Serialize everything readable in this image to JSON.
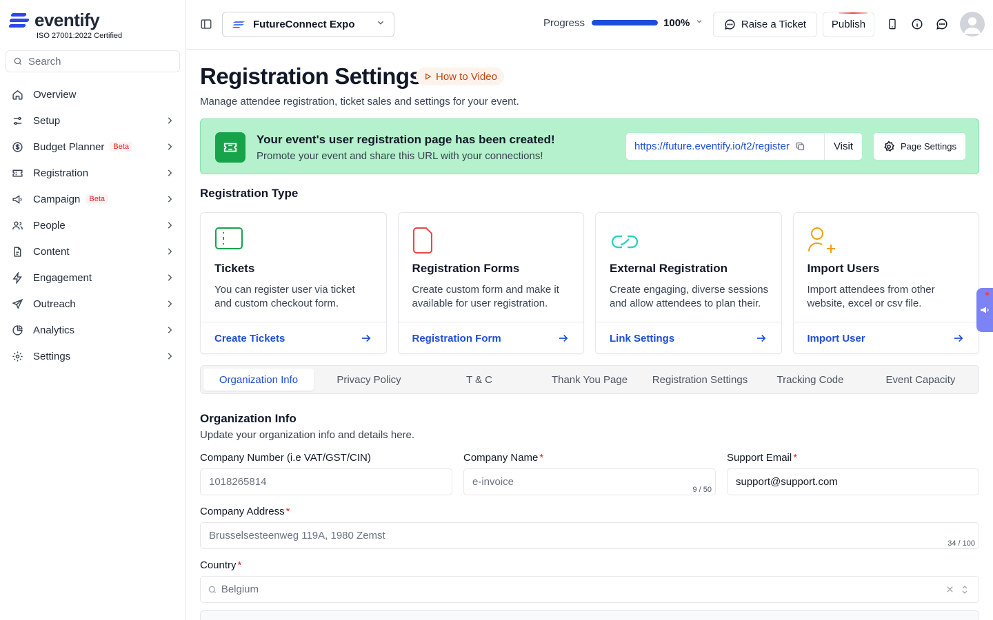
{
  "brand": {
    "name": "eventify",
    "certification": "ISO 27001:2022 Certified"
  },
  "sidebar": {
    "search_placeholder": "Search",
    "items": [
      {
        "label": "Overview",
        "icon": "home-icon",
        "has_chevron": false
      },
      {
        "label": "Setup",
        "icon": "sliders-icon",
        "has_chevron": true
      },
      {
        "label": "Budget Planner",
        "icon": "dollar-icon",
        "badge": "Beta",
        "has_chevron": true
      },
      {
        "label": "Registration",
        "icon": "ticket-icon",
        "has_chevron": true
      },
      {
        "label": "Campaign",
        "icon": "megaphone-icon",
        "badge": "Beta",
        "has_chevron": true
      },
      {
        "label": "People",
        "icon": "users-icon",
        "has_chevron": true
      },
      {
        "label": "Content",
        "icon": "document-icon",
        "has_chevron": true
      },
      {
        "label": "Engagement",
        "icon": "bolt-icon",
        "has_chevron": true
      },
      {
        "label": "Outreach",
        "icon": "send-icon",
        "has_chevron": true
      },
      {
        "label": "Analytics",
        "icon": "pie-chart-icon",
        "has_chevron": true
      },
      {
        "label": "Settings",
        "icon": "gear-icon",
        "has_chevron": true
      }
    ]
  },
  "topbar": {
    "event_name": "FutureConnect Expo",
    "progress_label": "Progress",
    "progress_value": 100,
    "progress_text": "100%",
    "raise_ticket": "Raise a Ticket",
    "publish": "Publish"
  },
  "page": {
    "title": "Registration Settings",
    "how_to": "How to Video",
    "subtitle": "Manage attendee registration, ticket sales and settings for your event."
  },
  "banner": {
    "title": "Your event's user registration page has been created!",
    "subtitle": "Promote your event and share this URL with your connections!",
    "url": "https://future.eventify.io/t2/register",
    "visit": "Visit",
    "page_settings": "Page Settings"
  },
  "registration_type": {
    "title": "Registration Type",
    "cards": [
      {
        "title": "Tickets",
        "desc": "You can register user via ticket and custom checkout form.",
        "link": "Create Tickets",
        "icon": "ticket-outline-icon",
        "color": "#16a34a"
      },
      {
        "title": "Registration Forms",
        "desc": "Create custom form and make it available for user registration.",
        "link": "Registration Form",
        "icon": "file-icon",
        "color": "#ef4444"
      },
      {
        "title": "External Registration",
        "desc": "Create engaging, diverse sessions and allow attendees to plan their.",
        "link": "Link Settings",
        "icon": "link-icon",
        "color": "#2dd4bf"
      },
      {
        "title": "Import Users",
        "desc": "Import attendees from other website, excel or csv file.",
        "link": "Import User",
        "icon": "user-plus-icon",
        "color": "#f59e0b"
      }
    ]
  },
  "tabs": [
    "Organization Info",
    "Privacy Policy",
    "T & C",
    "Thank You Page",
    "Registration Settings",
    "Tracking Code",
    "Event Capacity"
  ],
  "active_tab": 0,
  "org": {
    "title": "Organization Info",
    "subtitle": "Update your organization info and details here.",
    "company_number_label": "Company Number (i.e VAT/GST/CIN)",
    "company_number_placeholder": "1018265814",
    "company_name_label": "Company Name",
    "company_name_placeholder": "e-invoice",
    "company_name_counter": "9 / 50",
    "support_email_label": "Support Email",
    "support_email_value": "support@support.com",
    "address_label": "Company Address",
    "address_placeholder": "Brusselsesteenweg 119A, 1980 Zemst",
    "address_counter": "34 / 100",
    "country_label": "Country",
    "country_placeholder": "Belgium",
    "required_mark": "*"
  },
  "colors": {
    "accent": "#1d4ed8",
    "success_bg": "#b4f1cc",
    "brand": "#2b49ea",
    "danger": "#dc2626"
  }
}
